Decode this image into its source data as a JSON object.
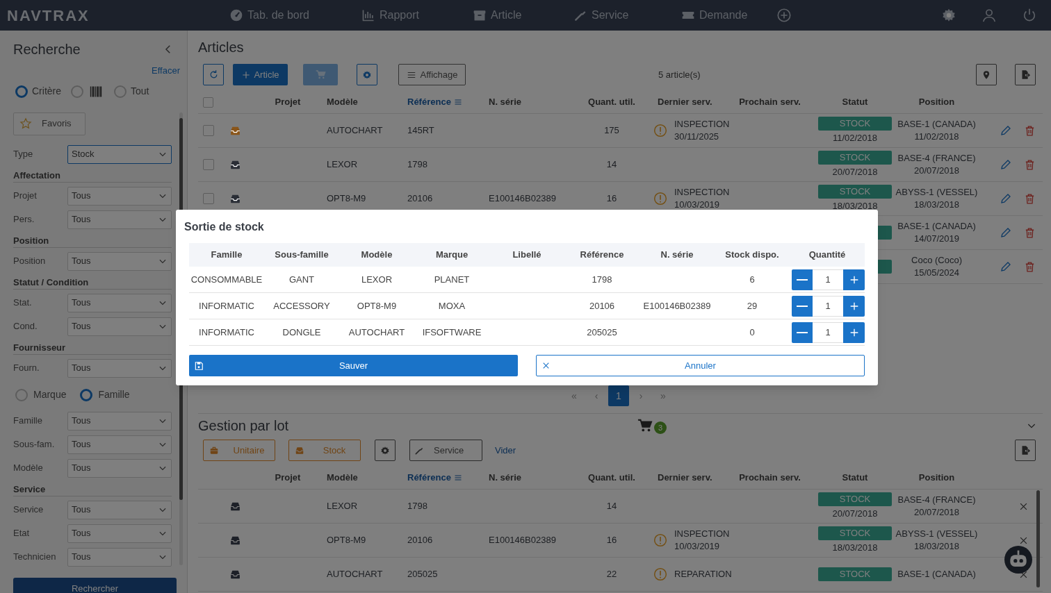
{
  "navbar": {
    "logo": "NAVTRAX",
    "items": [
      {
        "label": "Tab. de bord"
      },
      {
        "label": "Rapport"
      },
      {
        "label": "Article"
      },
      {
        "label": "Service"
      },
      {
        "label": "Demande"
      }
    ]
  },
  "sidebar": {
    "title": "Recherche",
    "clear_link": "Effacer",
    "modes": [
      {
        "kind": "text",
        "label": "Critère",
        "selected": true
      },
      {
        "kind": "barcode",
        "selected": false
      },
      {
        "kind": "text",
        "label": "Tout",
        "selected": false
      }
    ],
    "favorites_button": "Favoris",
    "filters": [
      {
        "kind": "select",
        "label": "Type",
        "value": "Stock",
        "focused": true
      },
      {
        "kind": "section",
        "label": "Affectation"
      },
      {
        "kind": "select",
        "label": "Projet",
        "value": "Tous",
        "focused": false
      },
      {
        "kind": "select",
        "label": "Pers.",
        "value": "Tous",
        "focused": false
      },
      {
        "kind": "section",
        "label": "Position"
      },
      {
        "kind": "select",
        "label": "Position",
        "value": "Tous",
        "focused": false
      },
      {
        "kind": "section",
        "label": "Statut / Condition"
      },
      {
        "kind": "select",
        "label": "Stat.",
        "value": "Tous",
        "focused": false
      },
      {
        "kind": "select",
        "label": "Cond.",
        "value": "Tous",
        "focused": false
      },
      {
        "kind": "section",
        "label": "Fournisseur"
      },
      {
        "kind": "select",
        "label": "Fourn.",
        "value": "Tous",
        "focused": false
      },
      {
        "kind": "radios",
        "options": [
          {
            "label": "Marque",
            "selected": false
          },
          {
            "label": "Famille",
            "selected": true
          }
        ]
      },
      {
        "kind": "select",
        "label": "Famille",
        "value": "Tous",
        "focused": false
      },
      {
        "kind": "select",
        "label": "Sous-fam.",
        "value": "Tous",
        "focused": false
      },
      {
        "kind": "select",
        "label": "Modèle",
        "value": "Tous",
        "focused": false
      },
      {
        "kind": "section",
        "label": "Service"
      },
      {
        "kind": "select",
        "label": "Service",
        "value": "Tous",
        "focused": false
      },
      {
        "kind": "select",
        "label": "Etat",
        "value": "Tous",
        "focused": false
      },
      {
        "kind": "select",
        "label": "Technicien",
        "value": "Tous",
        "focused": false
      }
    ],
    "search_button": "Rechercher"
  },
  "articles": {
    "title": "Articles",
    "select_all_checked": false,
    "add_button": "Article",
    "cart_disabled": true,
    "display_button": "Affichage",
    "count": "5 article(s)",
    "columns": [
      "Projet",
      "Modèle",
      "Référence",
      "N. série",
      "Quant. util.",
      "Dernier serv.",
      "Prochain serv.",
      "Statut",
      "Position"
    ],
    "rows": [
      {
        "checked": false,
        "color": "#8a5519",
        "model": "AUTOCHART",
        "reference": "145RT",
        "quantity": "175",
        "last_service": {
          "warning": true,
          "type": "INSPECTION",
          "date": "30/11/2025"
        },
        "status": "STOCK",
        "status_date": "11/02/2018",
        "position": "BASE-1 (CANADA)",
        "position_date": "11/02/2018"
      },
      {
        "checked": false,
        "color": "#2a2e36",
        "model": "LEXOR",
        "reference": "1798",
        "quantity": "14",
        "status": "STOCK",
        "status_date": "20/07/2018",
        "position": "BASE-4 (FRANCE)",
        "position_date": "20/07/2018"
      },
      {
        "checked": false,
        "color": "#2a2e36",
        "model": "OPT8-M9",
        "reference": "20106",
        "serial": "E100146B02389",
        "quantity": "16",
        "last_service": {
          "warning": true,
          "type": "INSPECTION",
          "date": "10/03/2019"
        },
        "status": "STOCK",
        "status_date": "18/03/2018",
        "position": "ABYSS-1 (VESSEL)",
        "position_date": "18/03/2018"
      },
      {
        "position": "BASE-1 (CANADA)",
        "position_date": "14/07/2019"
      },
      {
        "position": "Coco (Coco)",
        "position_date": "15/05/2024"
      }
    ],
    "pagination": [
      {
        "label": "«",
        "selected": false
      },
      {
        "label": "‹",
        "selected": false
      },
      {
        "label": "1",
        "selected": true
      },
      {
        "label": "›",
        "selected": false
      },
      {
        "label": "»",
        "selected": false
      }
    ]
  },
  "lot": {
    "title": "Gestion par lot",
    "cart_count": "3",
    "buttons": [
      "Unitaire",
      "Stock",
      "Service"
    ],
    "clear_link": "Vider",
    "columns": [
      "Projet",
      "Modèle",
      "Référence",
      "N. série",
      "Quant. util.",
      "Dernier serv.",
      "Prochain serv.",
      "Statut",
      "Position"
    ],
    "rows": [
      {
        "model": "LEXOR",
        "reference": "1798",
        "quantity": "14",
        "status": "STOCK",
        "status_date": "20/07/2018",
        "position": "BASE-4 (FRANCE)",
        "position_date": "20/07/2018"
      },
      {
        "model": "OPT8-M9",
        "reference": "20106",
        "serial": "E100146B02389",
        "quantity": "16",
        "last_service": {
          "warning": true,
          "type": "INSPECTION",
          "date": "10/03/2019"
        },
        "status": "STOCK",
        "status_date": "18/03/2018",
        "position": "ABYSS-1 (VESSEL)",
        "position_date": "18/03/2018"
      },
      {
        "model": "AUTOCHART",
        "reference": "205025",
        "quantity": "22",
        "last_service": {
          "warning": true,
          "type": "REPARATION"
        },
        "status": "STOCK",
        "position": "BASE-1 (CANADA)"
      }
    ]
  },
  "dialog": {
    "title": "Sortie de stock",
    "columns": [
      "Famille",
      "Sous-famille",
      "Modèle",
      "Marque",
      "Libellé",
      "Référence",
      "N. série",
      "Stock dispo.",
      "Quantité"
    ],
    "rows": [
      {
        "family": "CONSOMMABLE",
        "subfamily": "GANT",
        "model": "LEXOR",
        "brand": "PLANET",
        "reference": "1798",
        "stock": "6",
        "quantity": "1"
      },
      {
        "family": "INFORMATIC",
        "subfamily": "ACCESSORY",
        "model": "OPT8-M9",
        "brand": "MOXA",
        "reference": "20106",
        "serial": "E100146B02389",
        "stock": "29",
        "quantity": "1"
      },
      {
        "family": "INFORMATIC",
        "subfamily": "DONGLE",
        "model": "AUTOCHART",
        "brand": "IFSOFTWARE",
        "reference": "205025",
        "stock": "0",
        "quantity": "1"
      }
    ],
    "save_button": "Sauver",
    "cancel_button": "Annuler"
  }
}
